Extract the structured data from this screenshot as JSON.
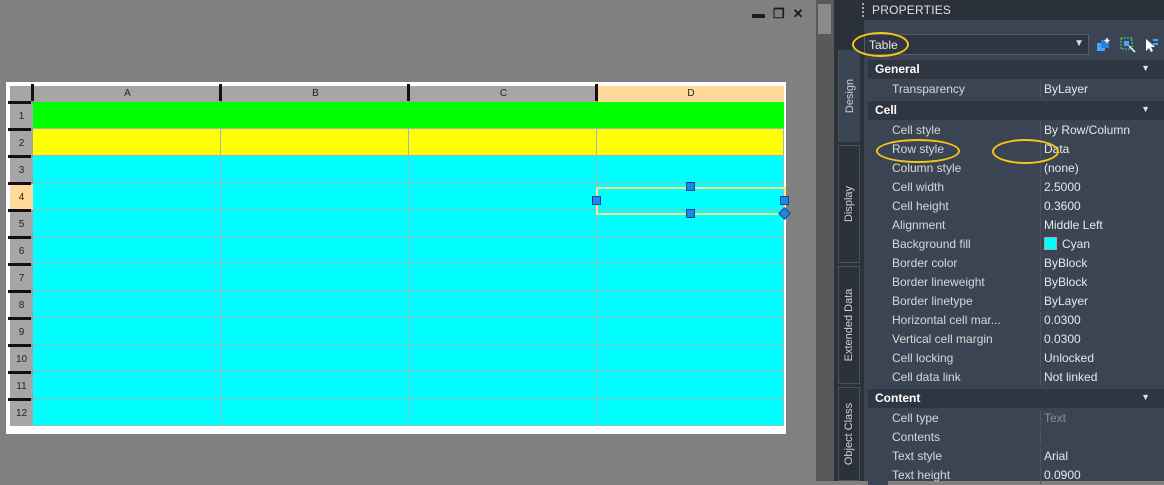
{
  "window_controls": {
    "minimize": "▬",
    "restore": "❐",
    "close": "✕"
  },
  "table": {
    "columns": [
      "A",
      "B",
      "C",
      "D"
    ],
    "rows": [
      "1",
      "2",
      "3",
      "4",
      "5",
      "6",
      "7",
      "8",
      "9",
      "10",
      "11",
      "12"
    ],
    "selected_column": "D",
    "selected_row": "4",
    "row_colors": [
      "#00ff00",
      "#ffff00",
      "#00ffff",
      "#00ffff",
      "#00ffff",
      "#00ffff",
      "#00ffff",
      "#00ffff",
      "#00ffff",
      "#00ffff",
      "#00ffff",
      "#00ffff"
    ]
  },
  "properties": {
    "title": "PROPERTIES",
    "object_type": "Table",
    "side_tabs": [
      "Design",
      "Display",
      "Extended Data",
      "Object Class"
    ],
    "sections": {
      "general": {
        "label": "General",
        "rows": [
          {
            "name": "Transparency",
            "value": "ByLayer"
          }
        ]
      },
      "cell": {
        "label": "Cell",
        "rows": [
          {
            "name": "Cell style",
            "value": "By Row/Column"
          },
          {
            "name": "Row style",
            "value": "Data"
          },
          {
            "name": "Column style",
            "value": "(none)"
          },
          {
            "name": "Cell width",
            "value": "2.5000"
          },
          {
            "name": "Cell height",
            "value": "0.3600"
          },
          {
            "name": "Alignment",
            "value": "Middle Left"
          },
          {
            "name": "Background fill",
            "value": "Cyan"
          },
          {
            "name": "Border color",
            "value": "ByBlock"
          },
          {
            "name": "Border lineweight",
            "value": "ByBlock"
          },
          {
            "name": "Border linetype",
            "value": "ByLayer"
          },
          {
            "name": "Horizontal cell mar...",
            "value": "0.0300"
          },
          {
            "name": "Vertical cell margin",
            "value": "0.0300"
          },
          {
            "name": "Cell locking",
            "value": "Unlocked"
          },
          {
            "name": "Cell data link",
            "value": "Not linked"
          }
        ]
      },
      "content": {
        "label": "Content",
        "rows": [
          {
            "name": "Cell type",
            "value": "Text"
          },
          {
            "name": "Contents",
            "value": ""
          },
          {
            "name": "Text style",
            "value": "Arial"
          },
          {
            "name": "Text height",
            "value": "0.0900"
          }
        ]
      }
    }
  }
}
